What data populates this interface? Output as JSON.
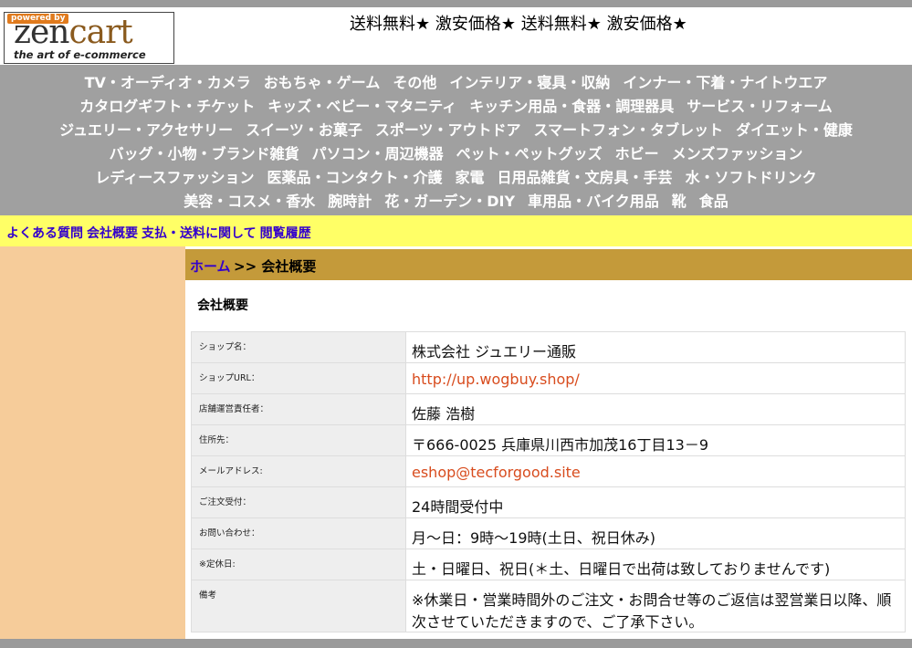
{
  "logo": {
    "powered_by": "powered by",
    "zen": "zen",
    "cart": "cart",
    "tagline": "the art of e-commerce"
  },
  "banner": "送料無料★ 激安価格★ 送料無料★ 激安価格★",
  "categories": [
    [
      "TV・オーディオ・カメラ",
      "おもちゃ・ゲーム",
      "その他",
      "インテリア・寝具・収納",
      "インナー・下着・ナイトウエア"
    ],
    [
      "カタログギフト・チケット",
      "キッズ・ベビー・マタニティ",
      "キッチン用品・食器・調理器具",
      "サービス・リフォーム"
    ],
    [
      "ジュエリー・アクセサリー",
      "スイーツ・お菓子",
      "スポーツ・アウトドア",
      "スマートフォン・タブレット",
      "ダイエット・健康"
    ],
    [
      "バッグ・小物・ブランド雑貨",
      "パソコン・周辺機器",
      "ペット・ペットグッズ",
      "ホビー",
      "メンズファッション"
    ],
    [
      "レディースファッション",
      "医薬品・コンタクト・介護",
      "家電",
      "日用品雑貨・文房具・手芸",
      "水・ソフトドリンク"
    ],
    [
      "美容・コスメ・香水",
      "腕時計",
      "花・ガーデン・DIY",
      "車用品・バイク用品",
      "靴",
      "食品"
    ]
  ],
  "help_links": [
    "よくある質問",
    "会社概要",
    "支払・送料に関して",
    "閲覧履歴"
  ],
  "breadcrumb": {
    "home": "ホーム",
    "rest": ">> 会社概要"
  },
  "page_title": "会社概要",
  "info_rows": [
    {
      "key": "ショップ名：",
      "value": "株式会社 ジュエリー通販",
      "link": false
    },
    {
      "key": "ショップURL：",
      "value": "http://up.wogbuy.shop/",
      "link": true
    },
    {
      "key": "店舗運営責任者：",
      "value": "佐藤 浩樹",
      "link": false
    },
    {
      "key": "住所先：",
      "value": "〒666-0025 兵庫県川西市加茂16丁目13－9",
      "link": false
    },
    {
      "key": "メールアドレス:",
      "value": "eshop@tecforgood.site",
      "link": true
    },
    {
      "key": "ご注文受付：",
      "value": "24時間受付中",
      "link": false
    },
    {
      "key": "お問い合わせ：",
      "value": "月～日：9時～19時(土日、祝日休み)",
      "link": false
    },
    {
      "key": "※定休日:",
      "value": "土・日曜日、祝日(＊土、日曜日で出荷は致しておりませんです)",
      "link": false
    },
    {
      "key": "備考",
      "value": "※休業日・営業時間外のご注文・お問合せ等のご返信は翌営業日以降、順次させていただきますので、ご了承下さい。",
      "link": false
    }
  ]
}
